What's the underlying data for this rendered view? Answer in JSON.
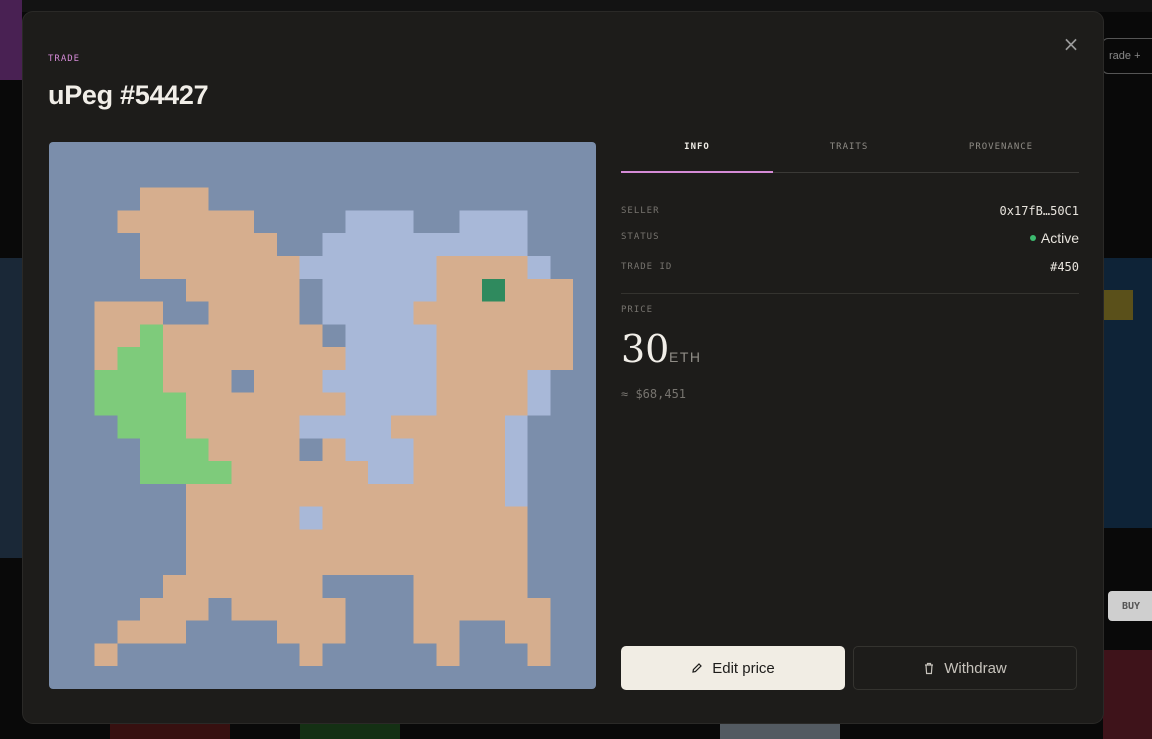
{
  "modal": {
    "eyebrow": "TRADE",
    "title": "uPeg #54427",
    "close_label": "×"
  },
  "tabs": [
    {
      "label": "INFO",
      "active": true
    },
    {
      "label": "TRAITS",
      "active": false
    },
    {
      "label": "PROVENANCE",
      "active": false
    }
  ],
  "info": {
    "seller_label": "SELLER",
    "seller_value": "0x17fB…50C1",
    "status_label": "STATUS",
    "status_value": "Active",
    "trade_id_label": "TRADE ID",
    "trade_id_value": "#450"
  },
  "price": {
    "label": "PRICE",
    "amount": "30",
    "unit": "ETH",
    "usd": "≈ $68,451"
  },
  "actions": {
    "edit_label": "Edit price",
    "withdraw_label": "Withdraw"
  },
  "background": {
    "buy_label": "BUY",
    "trade_label": "rade +"
  },
  "colors": {
    "accent": "#d48ad6",
    "status_dot": "#3cba6f",
    "art_bg": "#7b8eab",
    "body": "#d6ae8e",
    "wing": "#a8b8d8",
    "tail": "#7ecb7b",
    "eye": "#2f8a5e"
  }
}
